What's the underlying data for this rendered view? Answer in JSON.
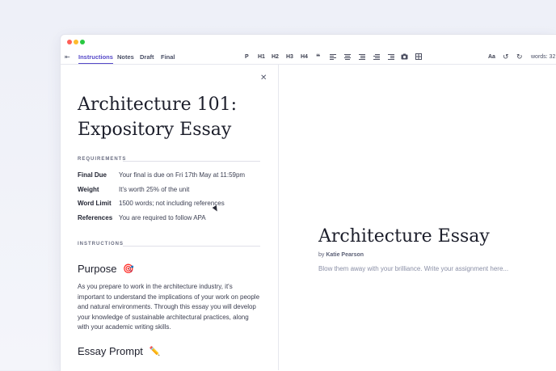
{
  "toolbar": {
    "tabs": [
      "Instructions",
      "Notes",
      "Draft",
      "Final"
    ],
    "format_buttons": [
      "P",
      "H1",
      "H2",
      "H3",
      "H4"
    ],
    "quote_glyph": "❝",
    "font_button": "Aa",
    "words_label": "words: 32"
  },
  "instructions": {
    "title_line1": "Architecture 101:",
    "title_line2": "Expository Essay",
    "requirements_label": "REQUIREMENTS",
    "requirements": [
      {
        "key": "Final Due",
        "value": "Your final is due on Fri 17th May at 11:59pm"
      },
      {
        "key": "Weight",
        "value": "It's worth 25% of the unit"
      },
      {
        "key": "Word Limit",
        "value": "1500 words; not including references"
      },
      {
        "key": "References",
        "value": "You are required to follow APA"
      }
    ],
    "instructions_label": "INSTRUCTIONS",
    "purpose_heading": "Purpose",
    "purpose_emoji": "🎯",
    "purpose_text": "As you prepare to work in the architecture industry, it's important to understand the implications of your work on people and natural environments. Through this essay you will develop your knowledge of sustainable architectural practices, along with your academic writing skills.",
    "prompt_heading": "Essay Prompt",
    "prompt_emoji": "✏️"
  },
  "editor": {
    "title": "Architecture Essay",
    "byline_prefix": "by",
    "author": "Katie Pearson",
    "placeholder": "Blow them away with your brilliance. Write your assignment here..."
  },
  "colors": {
    "accent": "#5548c8"
  }
}
